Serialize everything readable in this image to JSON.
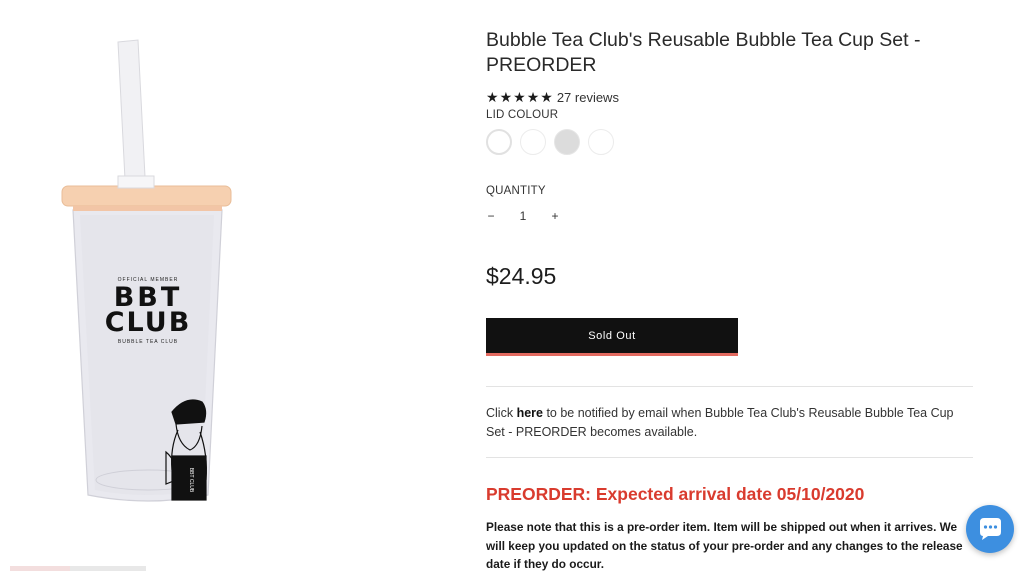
{
  "product": {
    "title": "Bubble Tea Club's Reusable Bubble Tea Cup Set - PREORDER",
    "image_text": {
      "cup_top": "OFFICIAL MEMBER",
      "cup_main_1": "BBT",
      "cup_main_2": "CLUB",
      "cup_bottom": "BUBBLE TEA CLUB",
      "cup_small": "BBT CLUB"
    },
    "rating": {
      "stars": 5,
      "reviews_label": "27 reviews"
    },
    "lid_colour": {
      "label": "LID COLOUR",
      "swatches": [
        "white",
        "white",
        "grey",
        "white"
      ],
      "selected_index": 0
    },
    "quantity": {
      "label": "QUANTITY",
      "minus": "−",
      "value": "1",
      "plus": "+"
    },
    "price": "$24.95",
    "sold_out_label": "Sold Out",
    "notify": {
      "before": "Click ",
      "link": "here",
      "after": " to be notified by email when Bubble Tea Club's Reusable Bubble Tea Cup Set - PREORDER becomes available."
    },
    "preorder_heading": "PREORDER: Expected arrival date 05/10/2020",
    "preorder_note": "Please note that this is a pre-order item. Item will be shipped out when it arrives. We will keep you updated on the status of your pre-order and any changes to the release date if they do occur."
  },
  "colors": {
    "accent_red": "#d93b2e",
    "button_underline": "#e36a60",
    "chat_blue": "#3d8fe0",
    "lid_peach": "#f6d0b0"
  },
  "icons": {
    "rating": "star-icon",
    "chat": "chat-bubble-icon"
  }
}
